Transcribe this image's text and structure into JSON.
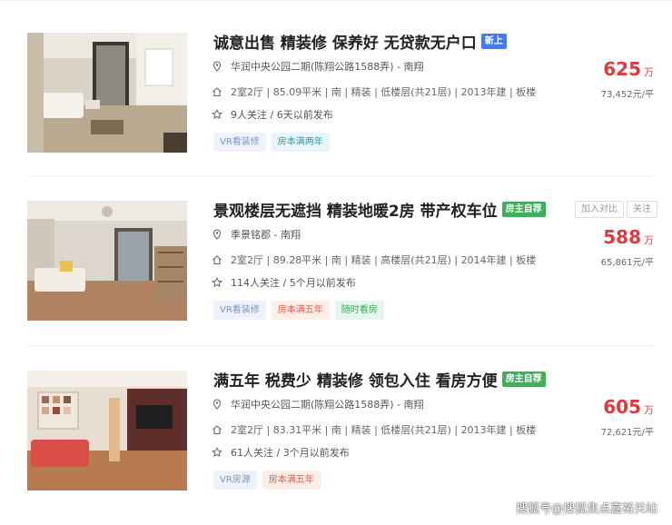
{
  "listings": [
    {
      "title": "诚意出售 精装修 保养好 无贷款无户口",
      "tag": "新上",
      "location": "华润中央公园二期(陈翔公路1588弄) - 南翔",
      "info": "2室2厅 | 85.09平米 | 南 | 精装 | 低楼层(共21层) | 2013年建 | 板楼",
      "follow": "9人关注 / 6天以前发布",
      "badges": [
        "VR看装修",
        "房本满两年"
      ],
      "price": "625",
      "price_unit": "万",
      "unit_price": "73,452元/平"
    },
    {
      "title": "景观楼层无遮挡 精装地暖2房 带产权车位",
      "tag": "房主自荐",
      "location": "季景铭郡 - 南翔",
      "info": "2室2厅 | 89.28平米 | 南 | 精装 | 高楼层(共21层) | 2014年建 | 板楼",
      "follow": "114人关注 / 5个月以前发布",
      "badges": [
        "VR看装修",
        "房本满五年",
        "随时看房"
      ],
      "price": "588",
      "price_unit": "万",
      "unit_price": "65,861元/平",
      "compare_label": "加入对比",
      "follow_label": "关注"
    },
    {
      "title": "满五年 税费少 精装修 领包入住 看房方便",
      "tag": "房主自荐",
      "location": "华润中央公园二期(陈翔公路1588弄) - 南翔",
      "info": "2室2厅 | 83.31平米 | 南 | 精装 | 低楼层(共21层) | 2013年建 | 板楼",
      "follow": "61人关注 / 3个月以前发布",
      "badges": [
        "VR房源",
        "房本满五年"
      ],
      "price": "605",
      "price_unit": "万",
      "unit_price": "72,621元/平"
    }
  ],
  "watermark": "搜狐号@搜狐焦点嘉裕关站",
  "colors": {
    "price": "#e4393c",
    "tag_new": "#3b7cf2",
    "tag_owner": "#3eaf5b"
  }
}
